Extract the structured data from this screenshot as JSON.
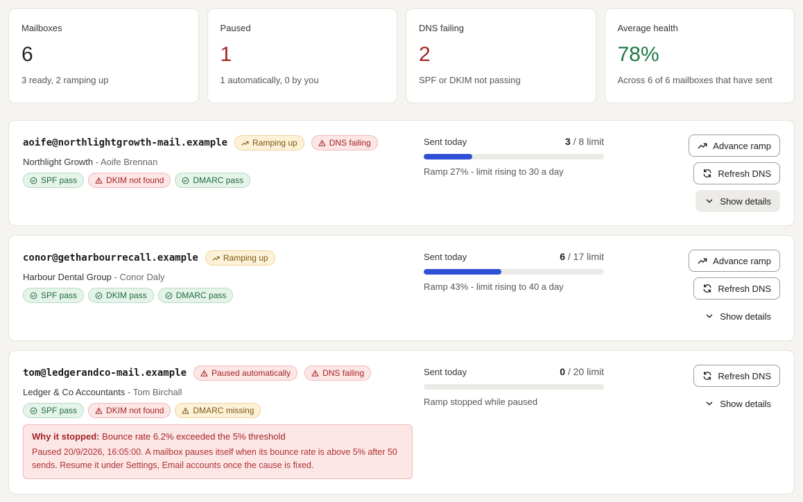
{
  "stats": [
    {
      "label": "Mailboxes",
      "value": "6",
      "color": "#1f2328",
      "sub": "3 ready, 2 ramping up"
    },
    {
      "label": "Paused",
      "value": "1",
      "color": "#a42424",
      "sub": "1 automatically, 0 by you"
    },
    {
      "label": "DNS failing",
      "value": "2",
      "color": "#a42424",
      "sub": "SPF or DKIM not passing"
    },
    {
      "label": "Average health",
      "value": "78%",
      "color": "#1e7a43",
      "sub": "Across 6 of 6 mailboxes that have sent"
    }
  ],
  "mailboxes": [
    {
      "email": "aoife@northlightgrowth-mail.example",
      "status_badges": [
        {
          "label": "Ramping up",
          "tone": "amber",
          "icon": "trend-up-icon"
        },
        {
          "label": "DNS failing",
          "tone": "red",
          "icon": "warning-icon"
        }
      ],
      "company": "Northlight Growth",
      "separator": " - ",
      "person": "Aoife Brennan",
      "dns_badges": [
        {
          "label": "SPF pass",
          "tone": "green",
          "icon": "check-circle-icon"
        },
        {
          "label": "DKIM not found",
          "tone": "red",
          "icon": "warning-icon"
        },
        {
          "label": "DMARC pass",
          "tone": "green",
          "icon": "check-circle-icon"
        }
      ],
      "sent_label": "Sent today",
      "sent": "3",
      "limit_text": " / 8 limit",
      "progress": 0.27,
      "ramp_note": "Ramp 27% - limit rising to 30 a day",
      "advance_label": "Advance ramp",
      "refresh_label": "Refresh DNS",
      "details_label": "Show details",
      "details_active": true
    },
    {
      "email": "conor@getharbourrecall.example",
      "status_badges": [
        {
          "label": "Ramping up",
          "tone": "amber",
          "icon": "trend-up-icon"
        }
      ],
      "company": "Harbour Dental Group",
      "separator": " - ",
      "person": "Conor Daly",
      "dns_badges": [
        {
          "label": "SPF pass",
          "tone": "green",
          "icon": "check-circle-icon"
        },
        {
          "label": "DKIM pass",
          "tone": "green",
          "icon": "check-circle-icon"
        },
        {
          "label": "DMARC pass",
          "tone": "green",
          "icon": "check-circle-icon"
        }
      ],
      "sent_label": "Sent today",
      "sent": "6",
      "limit_text": " / 17 limit",
      "progress": 0.43,
      "ramp_note": "Ramp 43% - limit rising to 40 a day",
      "advance_label": "Advance ramp",
      "refresh_label": "Refresh DNS",
      "details_label": "Show details",
      "details_active": false
    },
    {
      "email": "tom@ledgerandco-mail.example",
      "status_badges": [
        {
          "label": "Paused automatically",
          "tone": "red",
          "icon": "warning-icon"
        },
        {
          "label": "DNS failing",
          "tone": "red",
          "icon": "warning-icon"
        }
      ],
      "company": "Ledger & Co Accountants",
      "separator": " - ",
      "person": "Tom Birchall",
      "dns_badges": [
        {
          "label": "SPF pass",
          "tone": "green",
          "icon": "check-circle-icon"
        },
        {
          "label": "DKIM not found",
          "tone": "red",
          "icon": "warning-icon"
        },
        {
          "label": "DMARC missing",
          "tone": "amber",
          "icon": "warning-icon"
        }
      ],
      "sent_label": "Sent today",
      "sent": "0",
      "limit_text": " / 20 limit",
      "progress": 0,
      "ramp_note": "Ramp stopped while paused",
      "refresh_label": "Refresh DNS",
      "details_label": "Show details",
      "details_active": false,
      "alert": {
        "title_strong": "Why it stopped:",
        "title_rest": " Bounce rate 6.2% exceeded the 5% threshold",
        "body": "Paused 20/9/2026, 16:05:00. A mailbox pauses itself when its bounce rate is above 5% after 50 sends. Resume it under Settings, Email accounts once the cause is fixed."
      }
    }
  ]
}
